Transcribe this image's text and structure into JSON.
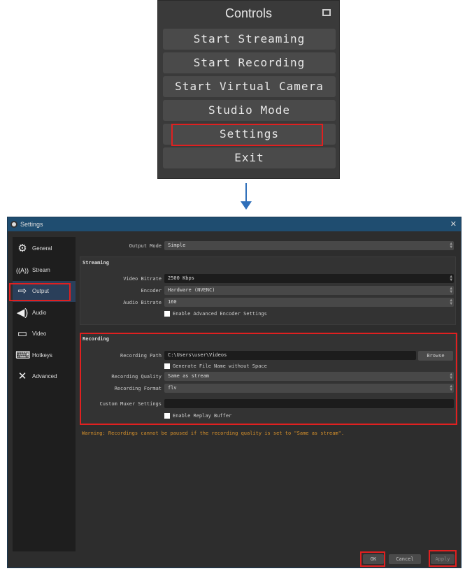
{
  "controls": {
    "title": "Controls",
    "buttons": [
      "Start Streaming",
      "Start Recording",
      "Start Virtual Camera",
      "Studio Mode",
      "Settings",
      "Exit"
    ]
  },
  "settings": {
    "title": "Settings",
    "sidebar": [
      {
        "label": "General",
        "icon": "gear-icon"
      },
      {
        "label": "Stream",
        "icon": "antenna-icon"
      },
      {
        "label": "Output",
        "icon": "output-icon"
      },
      {
        "label": "Audio",
        "icon": "speaker-icon"
      },
      {
        "label": "Video",
        "icon": "monitor-icon"
      },
      {
        "label": "Hotkeys",
        "icon": "keyboard-icon"
      },
      {
        "label": "Advanced",
        "icon": "tools-icon"
      }
    ],
    "output_mode": {
      "label": "Output Mode",
      "value": "Simple"
    },
    "streaming": {
      "title": "Streaming",
      "video_bitrate": {
        "label": "Video Bitrate",
        "value": "2500 Kbps"
      },
      "encoder": {
        "label": "Encoder",
        "value": "Hardware (NVENC)"
      },
      "audio_bitrate": {
        "label": "Audio Bitrate",
        "value": "160"
      },
      "advanced_encoder": "Enable Advanced Encoder Settings"
    },
    "recording": {
      "title": "Recording",
      "path": {
        "label": "Recording Path",
        "value": "C:\\Users\\user\\Videos"
      },
      "browse": "Browse",
      "gen_filename": "Generate File Name without Space",
      "quality": {
        "label": "Recording Quality",
        "value": "Same as stream"
      },
      "format": {
        "label": "Recording Format",
        "value": "flv"
      },
      "muxer": {
        "label": "Custom Muxer Settings",
        "value": ""
      },
      "replay_buffer": "Enable Replay Buffer"
    },
    "warning": "Warning: Recordings cannot be paused if the recording quality is set to \"Same as stream\".",
    "buttons": {
      "ok": "OK",
      "cancel": "Cancel",
      "apply": "Apply"
    }
  },
  "colors": {
    "highlight": "#e02020",
    "arrow": "#2f6fba",
    "warning": "#d9922b"
  }
}
